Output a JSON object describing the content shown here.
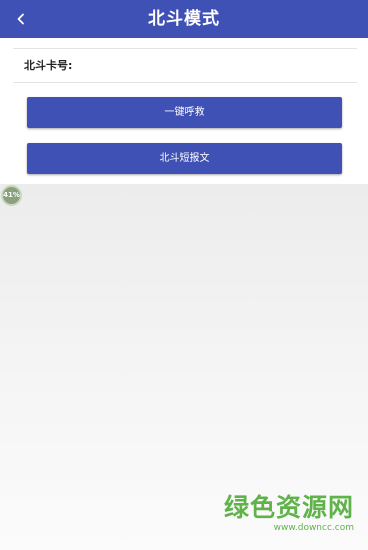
{
  "app_bar": {
    "back_icon": "chevron-left-icon",
    "title": "北斗模式",
    "color": "#3f51b5"
  },
  "card": {
    "label": "北斗卡号:"
  },
  "buttons": {
    "sos_label": "一键呼救",
    "message_label": "北斗短报文"
  },
  "progress_badge": "41%",
  "watermark": {
    "title": "绿色资源网",
    "url": "www.downcc.com",
    "color": "#5fb34a"
  }
}
